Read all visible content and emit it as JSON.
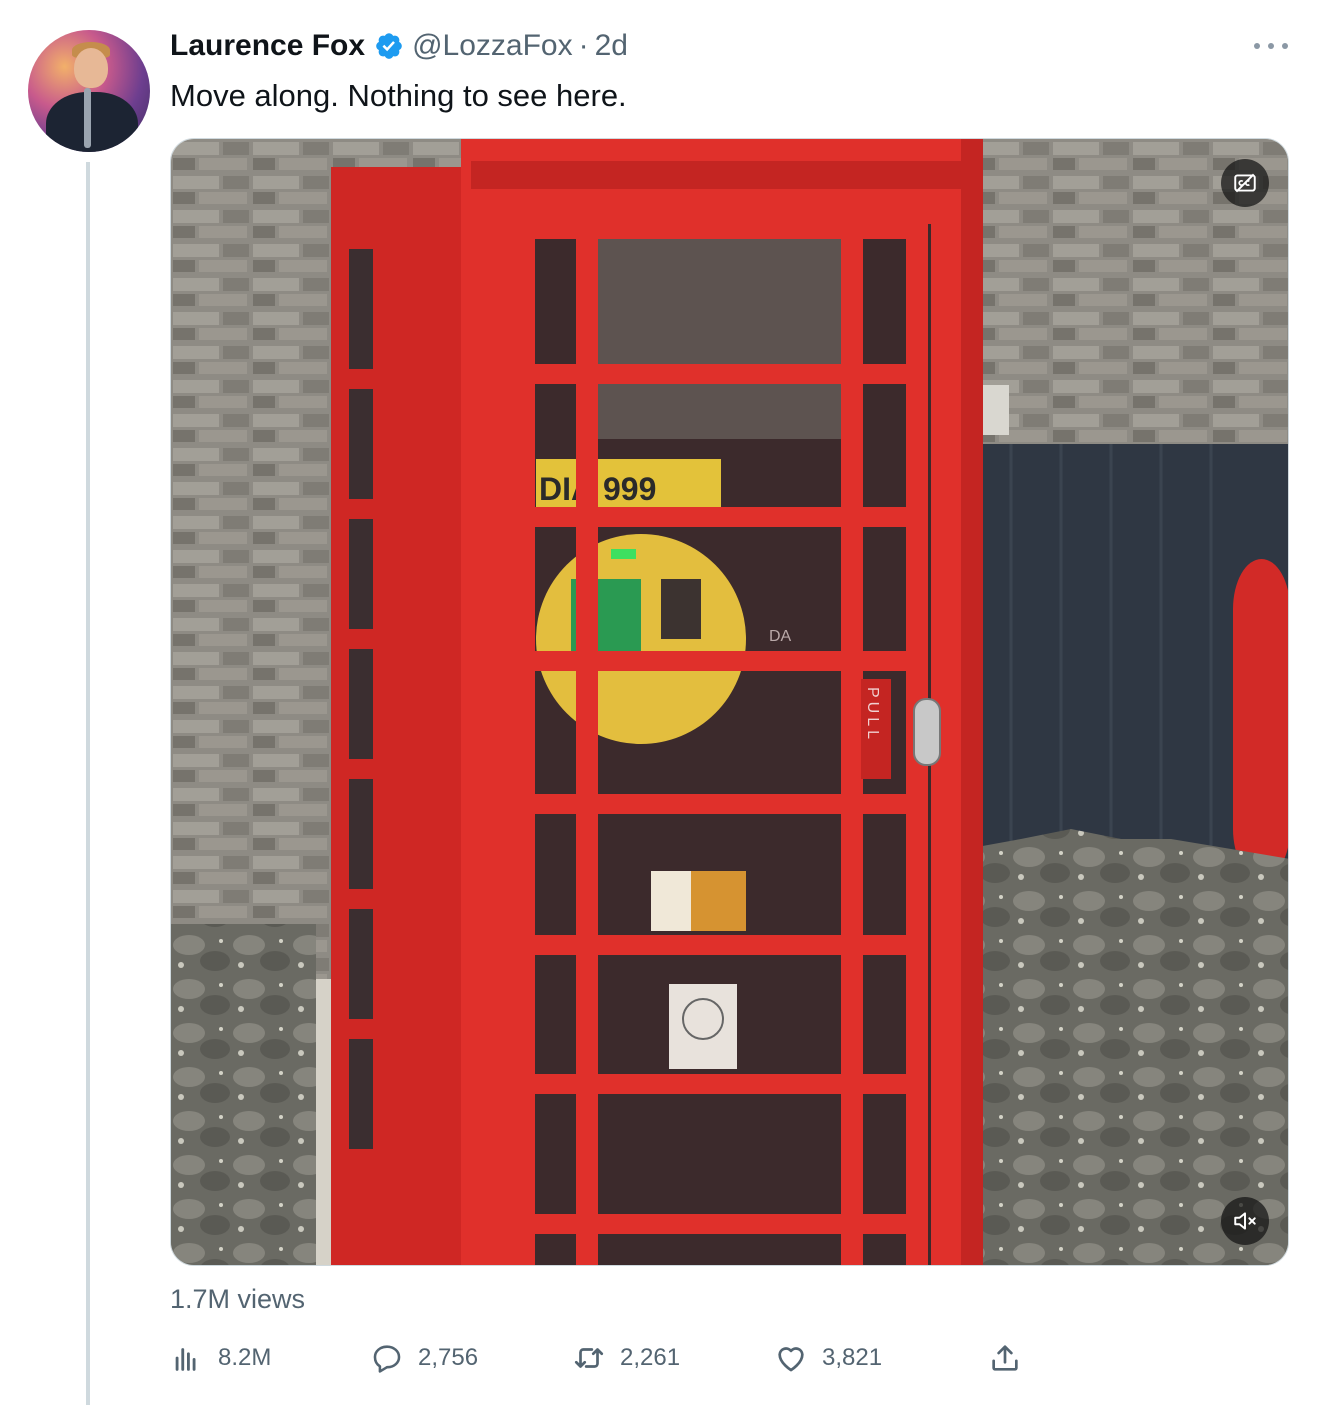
{
  "tweet": {
    "author_name": "Laurence Fox",
    "handle": "@LozzaFox",
    "separator": "·",
    "time": "2d",
    "text": "Move along. Nothing to see here.",
    "verified": true,
    "views_label": "1.7M views"
  },
  "media": {
    "type": "video",
    "sign_left": "DIA",
    "sign_number": "999",
    "door_label": "PULL",
    "inner_label": "DA",
    "captions_icon": "cc-off-icon",
    "mute_icon": "speaker-muted-icon"
  },
  "actions": {
    "views": {
      "icon": "bar-chart-icon",
      "count": "8.2M"
    },
    "reply": {
      "icon": "speech-bubble-icon",
      "count": "2,756"
    },
    "retweet": {
      "icon": "retweet-icon",
      "count": "2,261"
    },
    "like": {
      "icon": "heart-icon",
      "count": "3,821"
    },
    "share": {
      "icon": "share-upload-icon"
    }
  },
  "colors": {
    "text": "#0f1419",
    "secondary": "#536471",
    "verified": "#1d9bf0",
    "phone_box_red": "#e0302b"
  }
}
